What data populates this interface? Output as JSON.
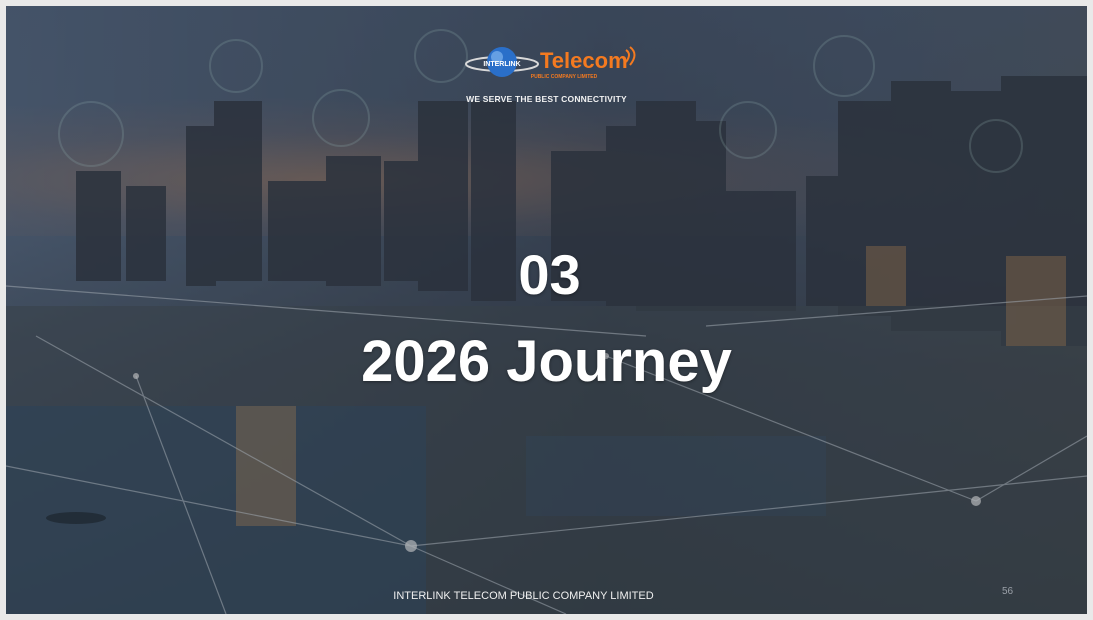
{
  "slide": {
    "logo_mark_text": "INTERLINK",
    "brand_name": "Telecom",
    "brand_subtitle": "PUBLIC COMPANY LIMITED",
    "tagline": "WE SERVE THE BEST CONNECTIVITY",
    "section_number": "03",
    "section_title": "2026 Journey",
    "footer": "INTERLINK TELECOM PUBLIC COMPANY LIMITED",
    "page_number": "56"
  },
  "colors": {
    "brand_orange": "#f47a20",
    "globe_blue": "#2a6fc9",
    "text_white": "#ffffff"
  }
}
